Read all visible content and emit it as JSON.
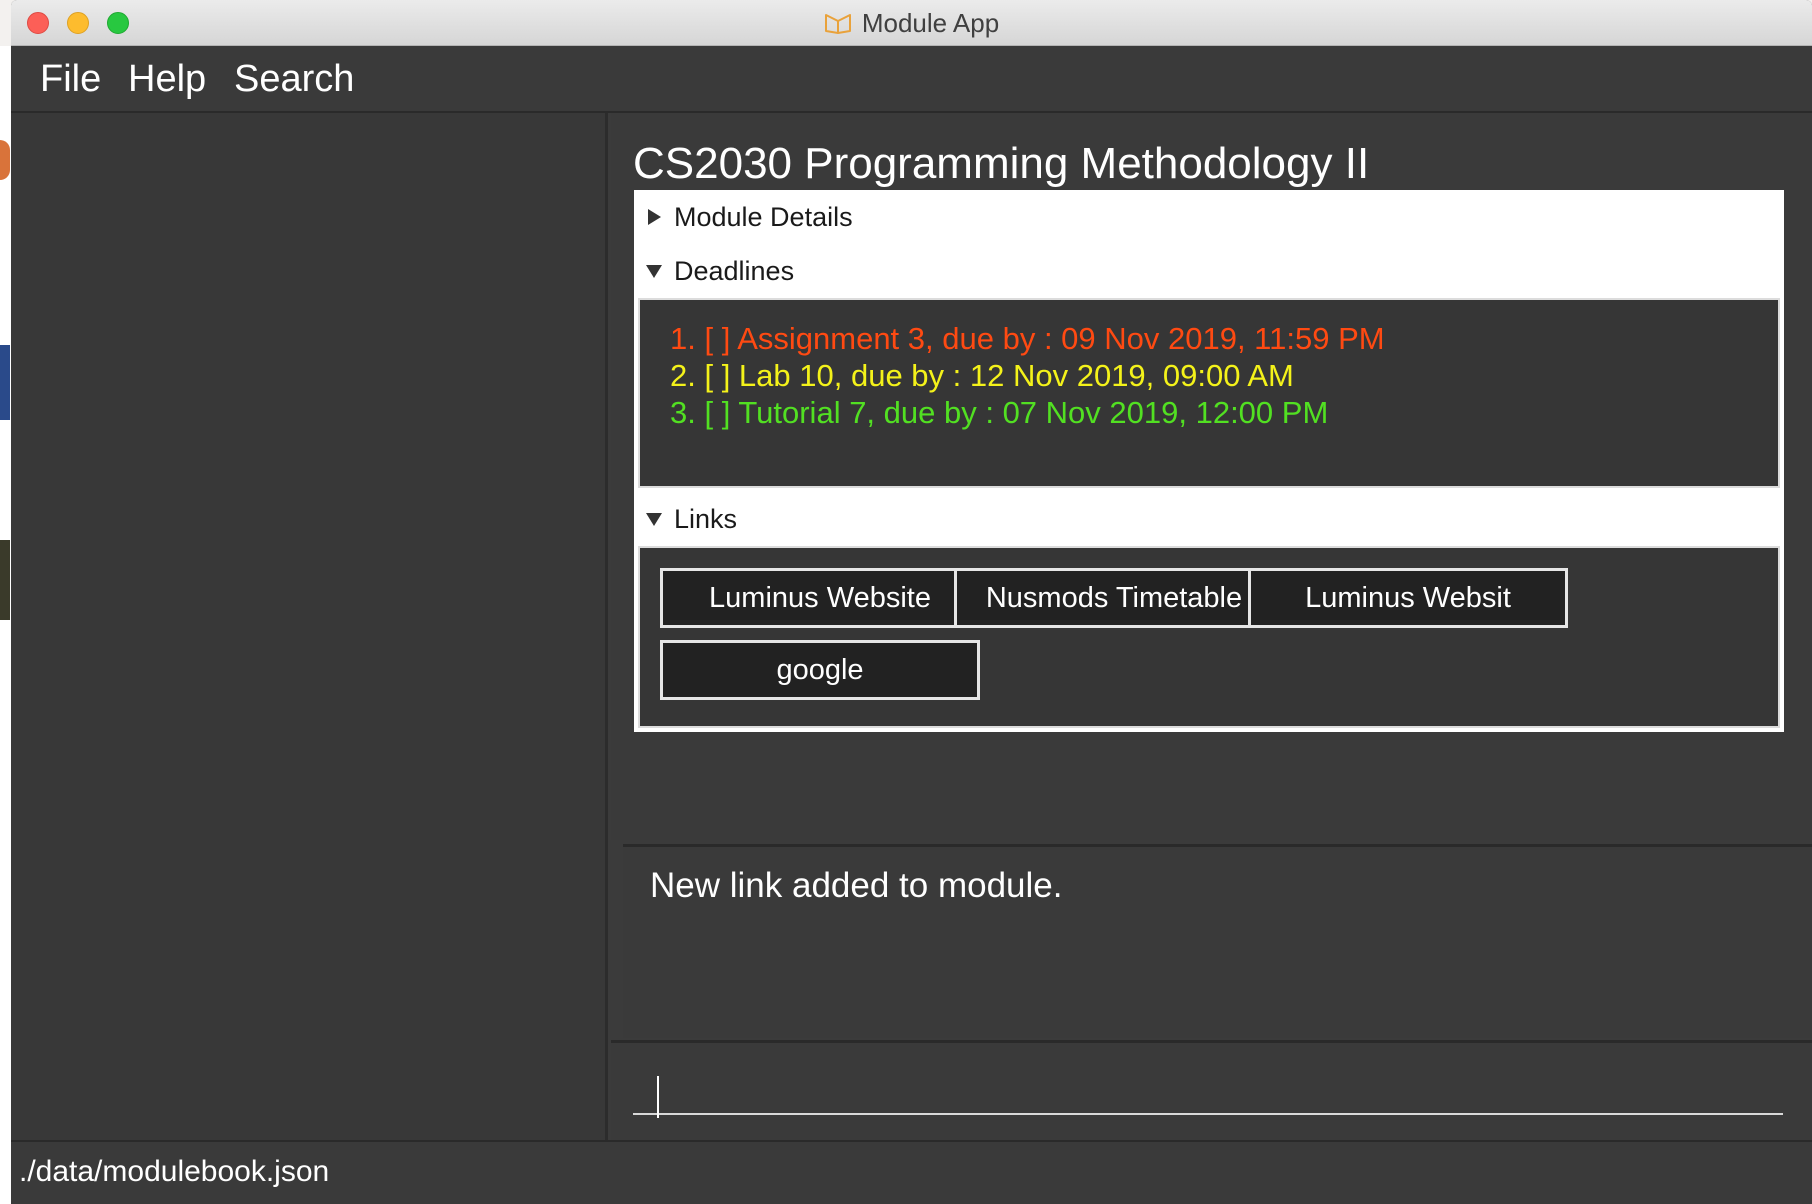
{
  "window": {
    "title": "Module App",
    "colors": {
      "close": "#fc5f57",
      "minimize": "#fdbc2e",
      "maximize": "#28c840",
      "app_icon": "#e9a23b"
    }
  },
  "menu": {
    "items": [
      {
        "label": "File"
      },
      {
        "label": "Help"
      },
      {
        "label": "Search"
      }
    ]
  },
  "module": {
    "title": "CS2030 Programming Methodology II",
    "sections": {
      "details": {
        "label": "Module Details",
        "expanded": false
      },
      "deadlines": {
        "label": "Deadlines",
        "expanded": true
      },
      "links": {
        "label": "Links",
        "expanded": true
      }
    },
    "deadlines": [
      {
        "text": "1. [ ] Assignment 3, due by : 09 Nov 2019, 11:59 PM",
        "color": "#ff4a12"
      },
      {
        "text": "2. [ ] Lab 10, due by : 12 Nov 2019, 09:00 AM",
        "color": "#f4f21a"
      },
      {
        "text": "3. [ ] Tutorial 7, due by : 07 Nov 2019, 12:00 PM",
        "color": "#52e022"
      }
    ],
    "links": [
      {
        "label": "Luminus Website"
      },
      {
        "label": "Nusmods Timetable"
      },
      {
        "label": "Luminus Websit"
      },
      {
        "label": "google"
      }
    ]
  },
  "result": {
    "message": "New link added to module."
  },
  "command": {
    "value": ""
  },
  "status": {
    "path": "./data/modulebook.json"
  }
}
